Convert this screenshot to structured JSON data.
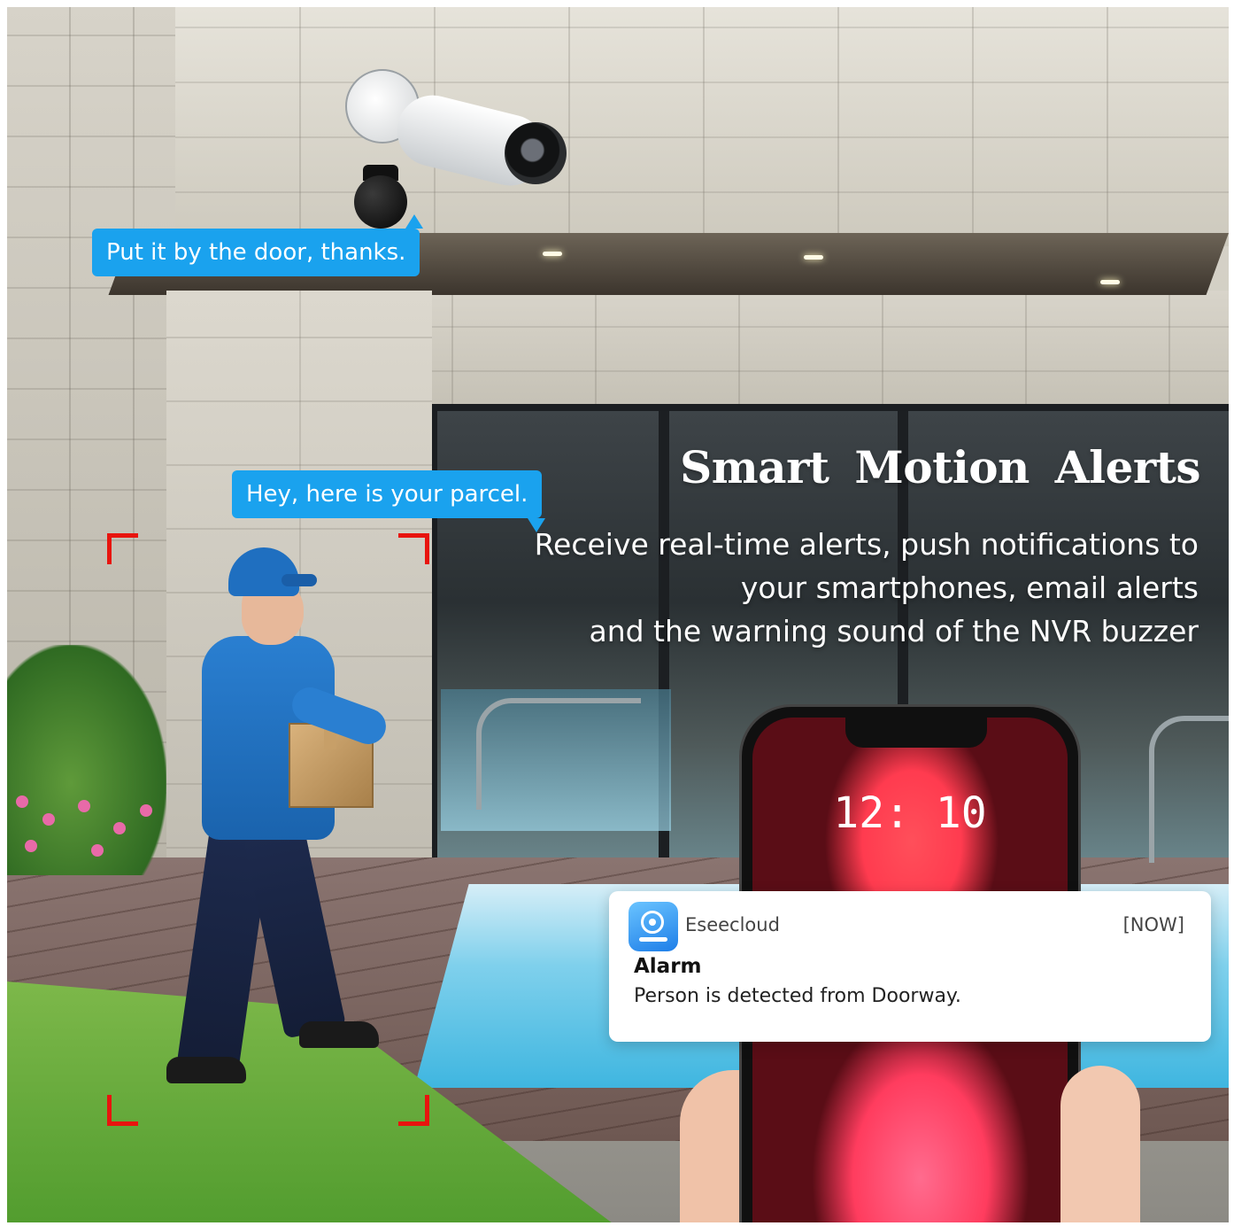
{
  "scene": {
    "bubble_top": "Put it by the door, thanks.",
    "bubble_person": "Hey, here is your parcel."
  },
  "headline": {
    "title": "Smart Motion Alerts",
    "lines": [
      "Receive real-time alerts, push notifications to",
      "your smartphones, email alerts",
      "and the warning sound of the NVR buzzer"
    ]
  },
  "phone": {
    "clock": "12: 10"
  },
  "notification": {
    "app_name": "Eseecloud",
    "time": "[NOW]",
    "title": "Alarm",
    "body": "Person is detected from Doorway.",
    "app_icon": "camera-icon"
  },
  "colors": {
    "bubble": "#1aa2ee",
    "detection_frame": "#e8140e",
    "app_icon": "#1e7ee8"
  }
}
